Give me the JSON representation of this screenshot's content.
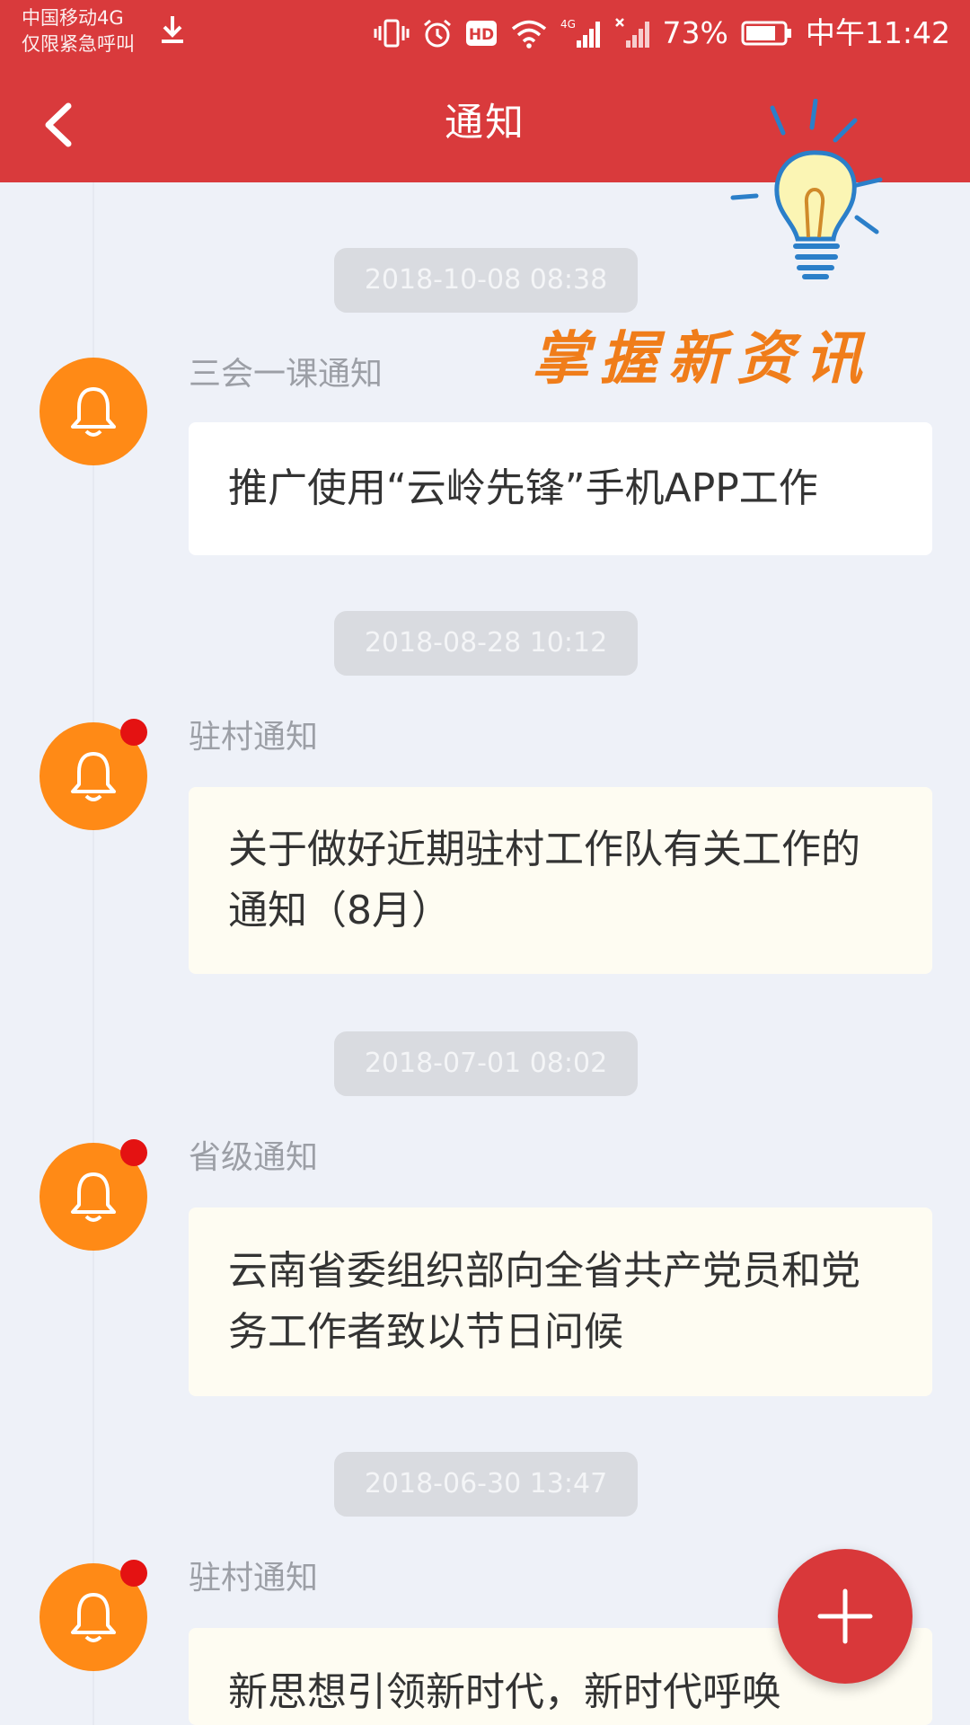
{
  "status_bar": {
    "carrier_line1": "中国移动4G",
    "carrier_line2": "仅限紧急呼叫",
    "battery_percent": "73%",
    "clock": "中午11:42",
    "icons": [
      "download-icon",
      "vibrate-icon",
      "alarm-icon",
      "hd-icon",
      "wifi-icon",
      "signal-4g-icon",
      "signal-no-service-icon",
      "battery-icon"
    ]
  },
  "header": {
    "title": "通知",
    "back_icon": "chevron-left-icon"
  },
  "overlay": {
    "slogan": "掌握新资讯",
    "icon": "lightbulb-icon"
  },
  "notifications": [
    {
      "time": "2018-10-08 08:38",
      "category": "三会一课通知",
      "message": "推广使用“云岭先锋”手机APP工作",
      "unread": false
    },
    {
      "time": "2018-08-28 10:12",
      "category": "驻村通知",
      "message": "关于做好近期驻村工作队有关工作的通知（8月）",
      "unread": true
    },
    {
      "time": "2018-07-01 08:02",
      "category": "省级通知",
      "message": "云南省委组织部向全省共产党员和党务工作者致以节日问候",
      "unread": true
    },
    {
      "time": "2018-06-30 13:47",
      "category": "驻村通知",
      "message": "新思想引领新时代，新时代呼唤",
      "unread": true
    }
  ],
  "fab": {
    "icon": "plus-icon"
  },
  "colors": {
    "header_red": "#d93a3c",
    "bell_orange": "#ff8a16",
    "unread_dot": "#e41212",
    "slogan_orange": "#f07d1a",
    "background": "#eef1f8"
  }
}
